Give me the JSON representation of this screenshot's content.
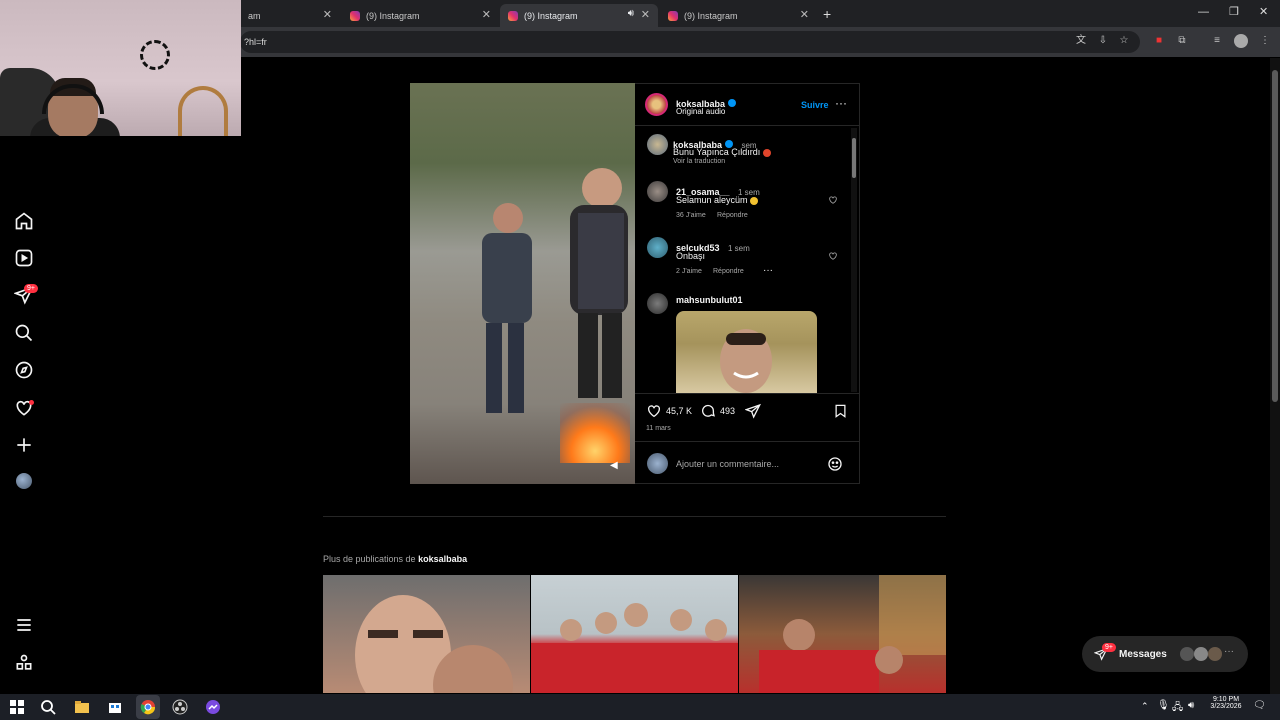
{
  "browser": {
    "tabs": [
      {
        "label": "am"
      },
      {
        "label": "(9) Instagram"
      },
      {
        "label": "(9) Instagram",
        "active": true
      },
      {
        "label": "(9) Instagram"
      }
    ],
    "url": "?hl=fr"
  },
  "nav": {
    "notifications_badge": "9+"
  },
  "post": {
    "author": "koksalbaba",
    "audio": "Original audio",
    "follow_label": "Suivre",
    "caption_author": "koksalbaba",
    "caption_time": "sem",
    "caption_text": "Bunu Yapınca Çıldırdı",
    "translate_label": "Voir la traduction",
    "comments": [
      {
        "user": "21_osama__",
        "time": "1 sem",
        "text": "Selamun aleycüm",
        "likes": "36 J'aime",
        "reply": "Répondre"
      },
      {
        "user": "selcukd53",
        "time": "1 sem",
        "text": "Onbaşı",
        "likes": "2 J'aime",
        "reply": "Répondre"
      },
      {
        "user": "mahsunbulut01"
      }
    ],
    "likes_count": "45,7 K",
    "comments_count": "493",
    "date": "11 mars",
    "comment_placeholder": "Ajouter un commentaire..."
  },
  "more_posts": {
    "prefix": "Plus de publications de",
    "author": "koksalbaba"
  },
  "messages": {
    "label": "Messages",
    "badge": "9+"
  },
  "taskbar": {
    "time": "9:10 PM",
    "date": "3/23/2026"
  },
  "colors": {
    "accent": "#0095f6",
    "notification": "#ff3040",
    "background": "#000000"
  }
}
